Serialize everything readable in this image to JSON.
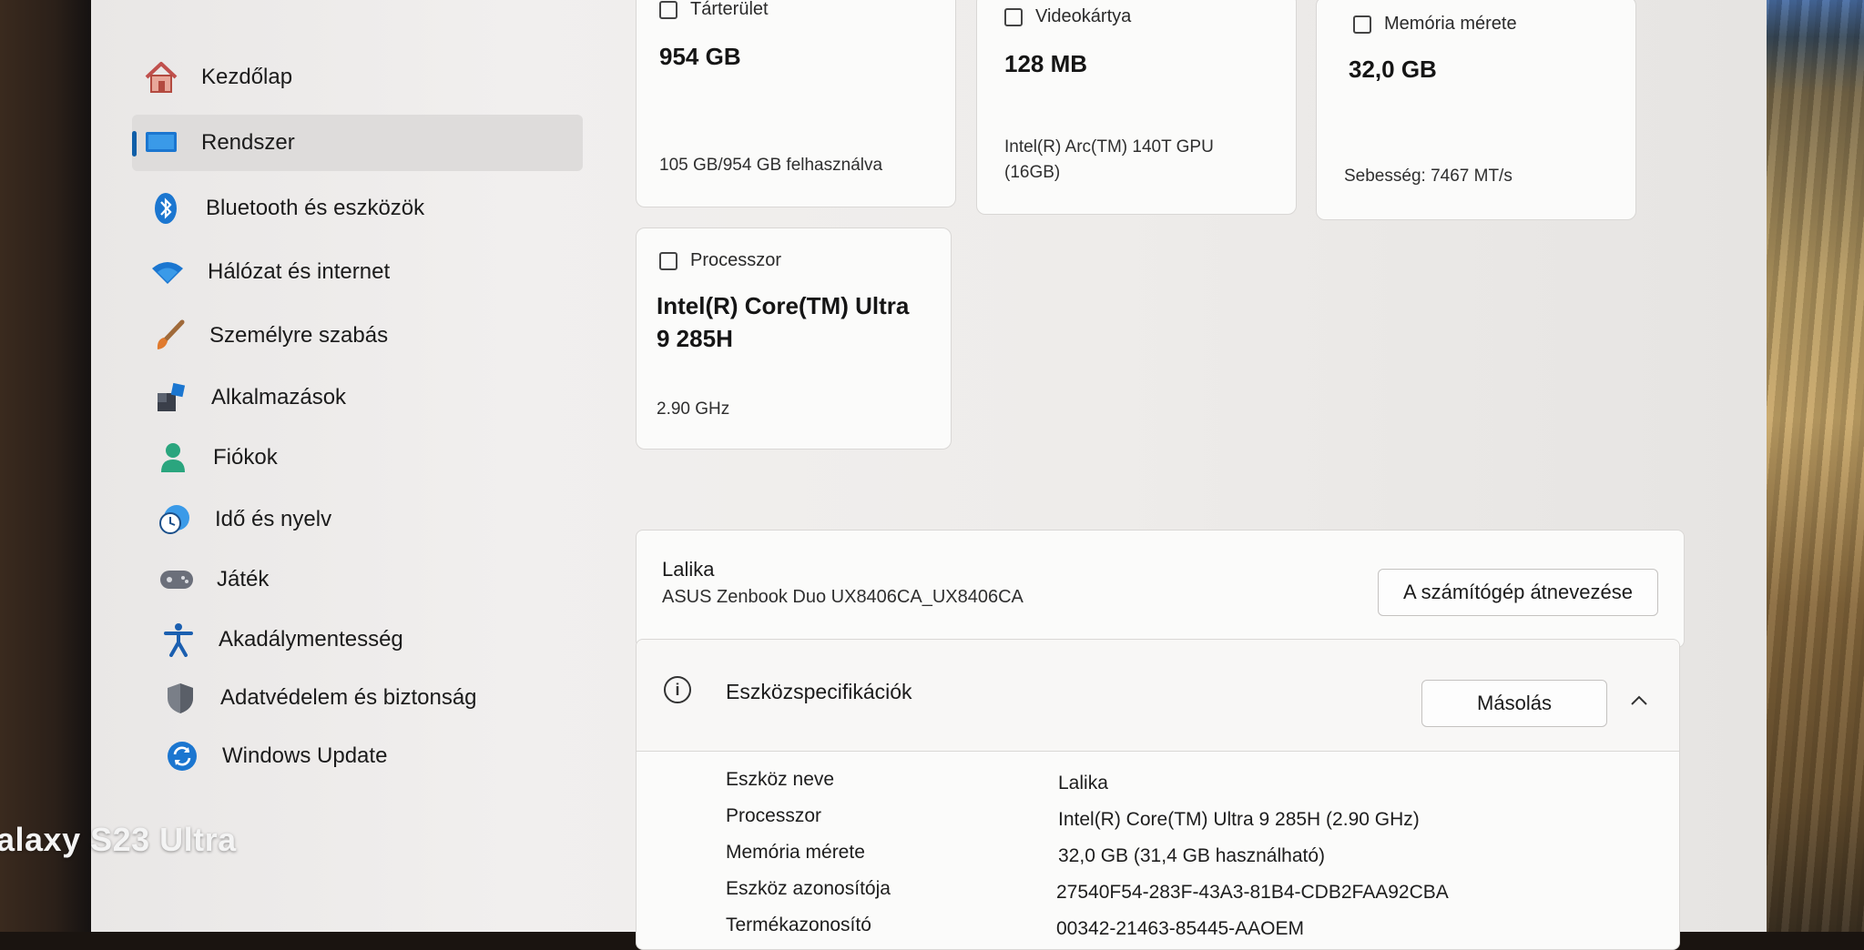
{
  "sidebar": {
    "items": [
      {
        "label": "Kezdőlap",
        "icon": "home-icon"
      },
      {
        "label": "Rendszer",
        "icon": "system-icon"
      },
      {
        "label": "Bluetooth és eszközök",
        "icon": "bluetooth-icon"
      },
      {
        "label": "Hálózat és internet",
        "icon": "wifi-icon"
      },
      {
        "label": "Személyre szabás",
        "icon": "brush-icon"
      },
      {
        "label": "Alkalmazások",
        "icon": "apps-icon"
      },
      {
        "label": "Fiókok",
        "icon": "person-icon"
      },
      {
        "label": "Idő és nyelv",
        "icon": "clock-globe-icon"
      },
      {
        "label": "Játék",
        "icon": "gamepad-icon"
      },
      {
        "label": "Akadálymentesség",
        "icon": "accessibility-icon"
      },
      {
        "label": "Adatvédelem és biztonság",
        "icon": "shield-icon"
      },
      {
        "label": "Windows Update",
        "icon": "update-icon"
      }
    ],
    "active_index": 1
  },
  "cards": {
    "storage": {
      "title": "Tárterület",
      "value": "954 GB",
      "detail": "105 GB/954 GB felhasználva"
    },
    "gpu": {
      "title": "Videokártya",
      "value": "128 MB",
      "detail_line1": "Intel(R) Arc(TM) 140T GPU",
      "detail_line2": "(16GB)"
    },
    "memory": {
      "title": "Memória mérete",
      "value": "32,0 GB",
      "detail": "Sebesség: 7467 MT/s"
    },
    "cpu": {
      "title": "Processzor",
      "value_line1": "Intel(R) Core(TM) Ultra",
      "value_line2": "9 285H",
      "detail": "2.90 GHz"
    }
  },
  "device": {
    "name": "Lalika",
    "model": "ASUS Zenbook Duo UX8406CA_UX8406CA",
    "rename_button": "A számítógép átnevezése"
  },
  "specs": {
    "title": "Eszközspecifikációk",
    "copy_button": "Másolás",
    "rows": [
      {
        "label": "Eszköz neve",
        "value": "Lalika"
      },
      {
        "label": "Processzor",
        "value": "Intel(R) Core(TM) Ultra 9 285H (2.90 GHz)"
      },
      {
        "label": "Memória mérete",
        "value": "32,0 GB (31,4 GB használható)"
      },
      {
        "label": "Eszköz azonosítója",
        "value": "27540F54-283F-43A3-81B4-CDB2FAA92CBA"
      },
      {
        "label": "Termékazonosító",
        "value": "00342-21463-85445-AAOEM"
      }
    ]
  },
  "watermark": "alaxy S23 Ultra",
  "colors": {
    "accent": "#0f5ea8"
  }
}
